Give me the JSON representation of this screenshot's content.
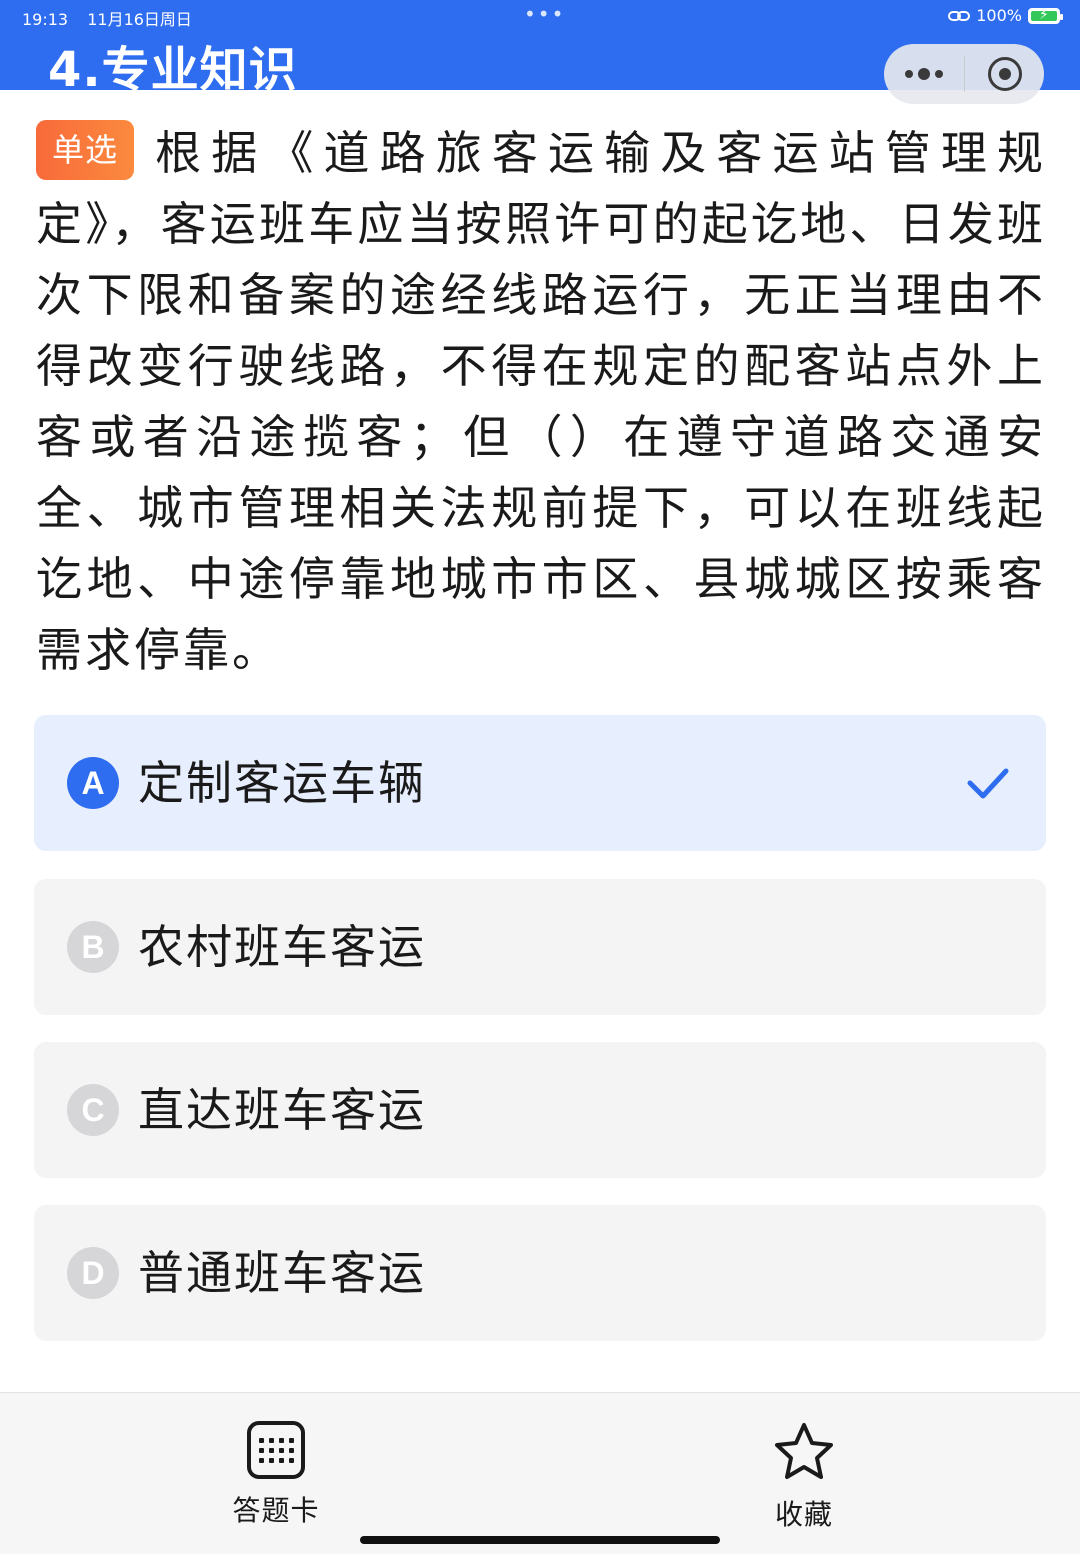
{
  "status_bar": {
    "time": "19:13",
    "date": "11月16日周日",
    "battery": "100%"
  },
  "header": {
    "title": "4.专业知识"
  },
  "question": {
    "type_badge": "单选",
    "text": "根据《道路旅客运输及客运站管理规定》，客运班车应当按照许可的起讫地、日发班次下限和备案的途经线路运行，无正当理由不得改变行驶线路，不得在规定的配客站点外上客或者沿途揽客；但（）在遵守道路交通安全、城市管理相关法规前提下，可以在班线起讫地、中途停靠地城市市区、县城城区按乘客需求停靠。"
  },
  "options": [
    {
      "letter": "A",
      "text": "定制客运车辆",
      "selected": true
    },
    {
      "letter": "B",
      "text": "农村班车客运",
      "selected": false
    },
    {
      "letter": "C",
      "text": "直达班车客运",
      "selected": false
    },
    {
      "letter": "D",
      "text": "普通班车客运",
      "selected": false
    }
  ],
  "bottom_bar": {
    "answer_card_label": "答题卡",
    "favorite_label": "收藏"
  },
  "colors": {
    "primary": "#2f6df0",
    "badge": "#f86a3a",
    "selected_bg": "#e7eefd",
    "option_bg": "#f4f4f5"
  },
  "icons": {
    "menu": "more-dots-icon",
    "close": "target-close-icon",
    "answer_card": "grid-icon",
    "favorite": "star-icon",
    "selected": "check-icon"
  }
}
